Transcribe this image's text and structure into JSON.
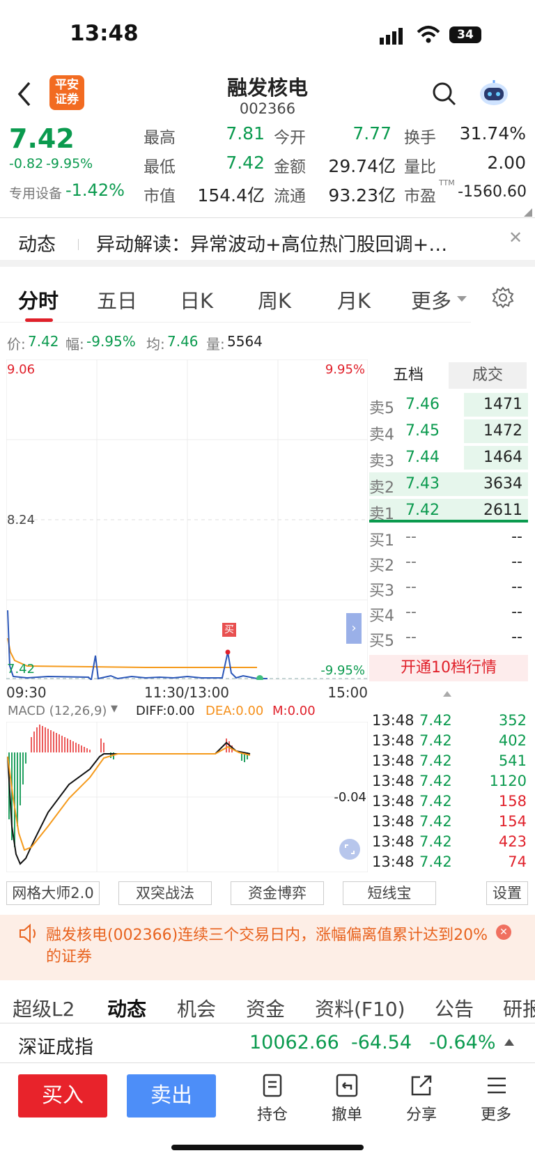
{
  "status": {
    "time": "13:48",
    "battery": "34"
  },
  "header": {
    "broker_logo": "平安证券",
    "name": "融发核电",
    "code": "002366"
  },
  "quote": {
    "price": "7.42",
    "change": "-0.82",
    "pct": "-9.95%",
    "sector": "专用设备",
    "sector_pct": "-1.42%",
    "high_l": "最高",
    "high": "7.81",
    "open_l": "今开",
    "open": "7.77",
    "turn_l": "换手",
    "turn": "31.74%",
    "low_l": "最低",
    "low": "7.42",
    "amt_l": "金额",
    "amt": "29.74亿",
    "vr_l": "量比",
    "vr": "2.00",
    "mcap_l": "市值",
    "mcap": "154.4亿",
    "float_l": "流通",
    "float": "93.23亿",
    "pe_l": "市盈",
    "pe_sup": "TTM",
    "pe": "-1560.60"
  },
  "news": {
    "label": "动态",
    "text": "异动解读：异常波动+高位热门股回调+…"
  },
  "tabs": [
    "分时",
    "五日",
    "日K",
    "周K",
    "月K",
    "更多"
  ],
  "info": {
    "p_l": "价:",
    "p": "7.42",
    "a_l": "幅:",
    "a": "-9.95%",
    "avg_l": "均:",
    "avg": "7.46",
    "v_l": "量:",
    "v": "5564"
  },
  "chart": {
    "y_top": "9.06",
    "y_mid": "8.24",
    "y_bot": "7.42",
    "pct_top": "9.95%",
    "pct_bot": "-9.95%",
    "t1": "09:30",
    "t2": "11:30/13:00",
    "t3": "15:00",
    "buy_mark": "买"
  },
  "macd": {
    "name": "MACD (12,26,9)",
    "diff": "DIFF:0.00",
    "dea": "DEA:0.00",
    "m": "M:0.00",
    "level": "-0.04"
  },
  "orderbook": {
    "tab1": "五档",
    "tab2": "成交",
    "asks": [
      {
        "l": "卖5",
        "p": "7.46",
        "v": "1471"
      },
      {
        "l": "卖4",
        "p": "7.45",
        "v": "1472"
      },
      {
        "l": "卖3",
        "p": "7.44",
        "v": "1464"
      },
      {
        "l": "卖2",
        "p": "7.43",
        "v": "3634"
      },
      {
        "l": "卖1",
        "p": "7.42",
        "v": "2611"
      }
    ],
    "bids": [
      {
        "l": "买1",
        "p": "--",
        "v": "--"
      },
      {
        "l": "买2",
        "p": "--",
        "v": "--"
      },
      {
        "l": "买3",
        "p": "--",
        "v": "--"
      },
      {
        "l": "买4",
        "p": "--",
        "v": "--"
      },
      {
        "l": "买5",
        "p": "--",
        "v": "--"
      }
    ],
    "open10": "开通10档行情"
  },
  "ticks": [
    {
      "t": "13:48",
      "p": "7.42",
      "v": "352",
      "c": "g"
    },
    {
      "t": "13:48",
      "p": "7.42",
      "v": "402",
      "c": "g"
    },
    {
      "t": "13:48",
      "p": "7.42",
      "v": "541",
      "c": "g"
    },
    {
      "t": "13:48",
      "p": "7.42",
      "v": "1120",
      "c": "g"
    },
    {
      "t": "13:48",
      "p": "7.42",
      "v": "158",
      "c": "r"
    },
    {
      "t": "13:48",
      "p": "7.42",
      "v": "154",
      "c": "r"
    },
    {
      "t": "13:48",
      "p": "7.42",
      "v": "423",
      "c": "r"
    },
    {
      "t": "13:48",
      "p": "7.42",
      "v": "74",
      "c": "r"
    }
  ],
  "tools": [
    "网格大师2.0",
    "双突战法",
    "资金博弈",
    "短线宝",
    "设置"
  ],
  "notice": "融发核电(002366)连续三个交易日内，涨幅偏离值累计达到20%的证券",
  "btabs": [
    "超级L2",
    "动态",
    "机会",
    "资金",
    "资料(F10)",
    "公告",
    "研报"
  ],
  "index": {
    "name": "深证成指",
    "val": "10062.66",
    "chg": "-64.54",
    "pct": "-0.64%"
  },
  "bottom": {
    "buy": "买入",
    "sell": "卖出",
    "hold": "持仓",
    "cancel": "撤单",
    "share": "分享",
    "more": "更多"
  }
}
